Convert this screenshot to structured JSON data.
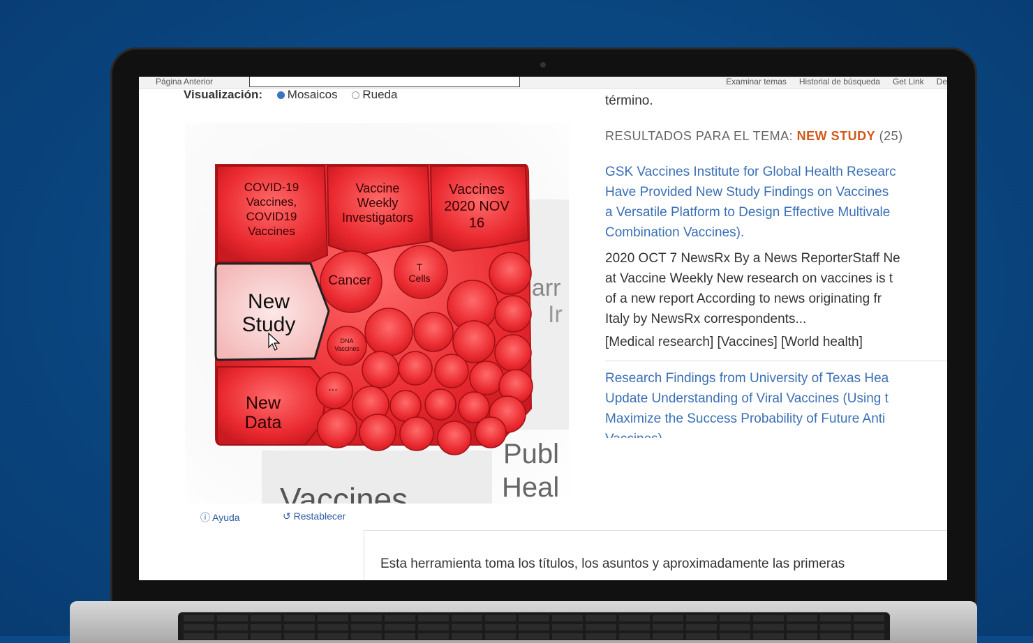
{
  "topbar": {
    "prev_page": "Página Anterior",
    "links": [
      "Examinar temas",
      "Historial de búsqueda",
      "Get Link",
      "De"
    ]
  },
  "visualization": {
    "label": "Visualización:",
    "options": [
      "Mosaicos",
      "Rueda"
    ],
    "selected": "Mosaicos"
  },
  "tiles": {
    "covid": "COVID-19 Vaccines, COVID19 Vaccines",
    "vaccine_weekly": "Vaccine Weekly Investigators",
    "vaccines_2020": "Vaccines 2020 NOV 16",
    "new_study": "New Study",
    "cancer": "Cancer",
    "t_cells": "T Cells",
    "dna_vaccines": "DNA Vaccines",
    "ellipsis": "...",
    "new_data": "New Data"
  },
  "wheel_bg": {
    "word_1": "harr",
    "word_2": "Ir",
    "word_3": "Publ",
    "word_4": "Heal",
    "word_5": "Vaccines"
  },
  "footer_links": {
    "help": "Ayuda",
    "reset": "Restablecer"
  },
  "description": "Esta herramienta toma los títulos, los asuntos y aproximadamente las primeras",
  "results": {
    "lead": "término.",
    "heading": "RESULTADOS PARA EL TEMA:",
    "topic": "NEW STUDY",
    "count": "(25)",
    "items": [
      {
        "title_lines": [
          "GSK Vaccines Institute for Global Health Researc",
          "Have Provided New Study Findings on Vaccines",
          "a Versatile Platform to Design Effective Multivale",
          "Combination Vaccines)."
        ],
        "body_lines": [
          "2020 OCT 7 NewsRx By a News ReporterStaff Ne",
          "at Vaccine Weekly New research on vaccines is t",
          "of a new report According to news originating fr",
          "Italy by NewsRx correspondents..."
        ],
        "tags": "[Medical research] [Vaccines] [World health]"
      },
      {
        "title_lines": [
          "Research Findings from University of Texas Hea",
          "Update Understanding of Viral Vaccines (Using t",
          "Maximize the Success Probability of Future Anti",
          "Vaccines)"
        ]
      }
    ]
  },
  "colors": {
    "background": "#0b4a86",
    "tile_red": "#e8262c",
    "selected_tile": "#f7c9c9",
    "link_blue": "#3a6fb5",
    "topic_orange": "#d2581a"
  }
}
